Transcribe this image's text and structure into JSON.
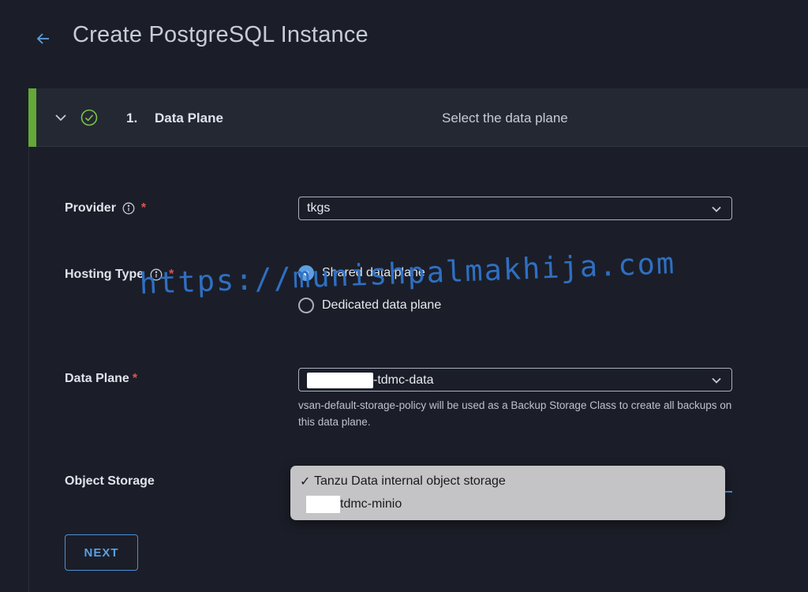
{
  "header": {
    "title": "Create PostgreSQL Instance"
  },
  "step": {
    "number": "1.",
    "title": "Data Plane",
    "description": "Select the data plane",
    "status": "complete"
  },
  "form": {
    "provider": {
      "label": "Provider",
      "required_mark": "*",
      "value": "tkgs"
    },
    "hosting_type": {
      "label": "Hosting Type",
      "required_mark": "*",
      "options": [
        {
          "label": "Shared data plane",
          "selected": true
        },
        {
          "label": "Dedicated data plane",
          "selected": false
        }
      ]
    },
    "data_plane": {
      "label": "Data Plane",
      "required_mark": "*",
      "value_suffix": "-tdmc-data",
      "helper_text": "vsan-default-storage-policy will be used as a Backup Storage Class to create all backups on this data plane."
    },
    "object_storage": {
      "label": "Object Storage",
      "dropdown_options": [
        {
          "label": "Tanzu Data internal object storage",
          "checked": true,
          "check_mark": "✓"
        },
        {
          "label": "tdmc-minio",
          "checked": false,
          "check_mark": ""
        }
      ]
    }
  },
  "actions": {
    "next_label": "NEXT"
  },
  "watermark": "https://munishpalmakhija.com",
  "colors": {
    "background": "#1b1e28",
    "step_bar": "#242833",
    "accent_green": "#63a838",
    "link_blue": "#5d9fe0",
    "required_red": "#e05252",
    "dropdown_bg": "#c4c4c6"
  }
}
